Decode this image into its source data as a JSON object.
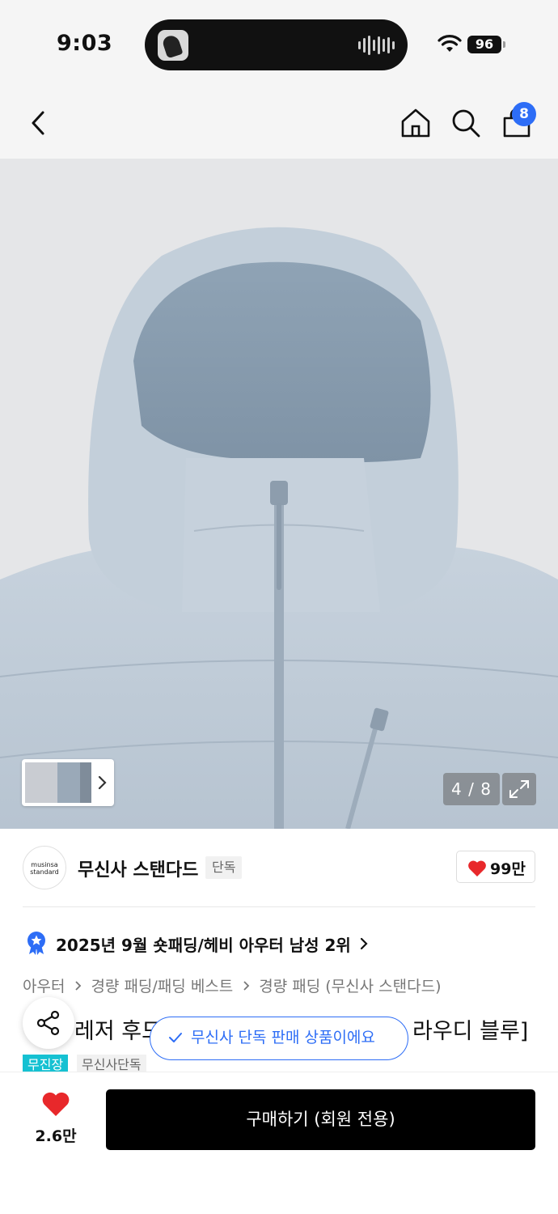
{
  "status_bar": {
    "time": "9:03",
    "battery": "96"
  },
  "nav": {
    "cart_count": "8"
  },
  "gallery": {
    "counter": "4 / 8"
  },
  "brand": {
    "logo_line1": "musinsa",
    "logo_line2": "standard",
    "name": "무신사 스탠다드",
    "tag": "단독",
    "likes": "99만"
  },
  "ranking": {
    "text": "2025년 9월 숏패딩/헤비 아우터 남성 2위"
  },
  "breadcrumb": [
    "아우터",
    "경량 패딩/패딩 베스트",
    "경량 패딩 (무신사 스탠다드)"
  ],
  "product": {
    "title_visible_left": "레저 후드",
    "title_visible_right": "라우디 블루]"
  },
  "toast": {
    "text": "무신사 단독 판매 상품이에요"
  },
  "tags": [
    "무진장",
    "무신사단독"
  ],
  "bottom": {
    "favorite_count": "2.6만",
    "buy_label": "구매하기 (회원 전용)"
  },
  "colors": {
    "accent_blue": "#2d6df6",
    "heart_red": "#e8282b",
    "tag_cyan": "#15c1d2",
    "buy_black": "#000000"
  }
}
